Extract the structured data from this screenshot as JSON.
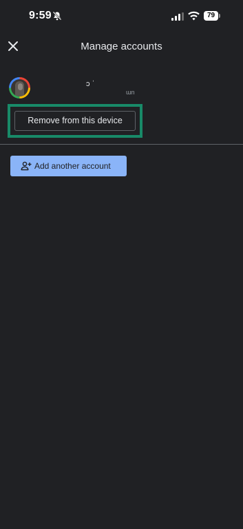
{
  "status_bar": {
    "time": "9:59",
    "battery": "79",
    "icons": [
      "bell-slash-icon",
      "signal-icon",
      "wifi-icon",
      "battery-icon"
    ]
  },
  "header": {
    "title": "Manage accounts",
    "close_icon": "close-icon"
  },
  "account": {
    "name": "ɔ  ˈ",
    "email": "ɯn"
  },
  "actions": {
    "remove_label": "Remove from this device",
    "add_account_label": "Add another account",
    "add_icon": "add-person-icon"
  },
  "colors": {
    "background": "#202124",
    "text": "#e8eaed",
    "highlight": "#188a68",
    "primary_button": "#8ab4f8",
    "divider": "#5f6368"
  }
}
